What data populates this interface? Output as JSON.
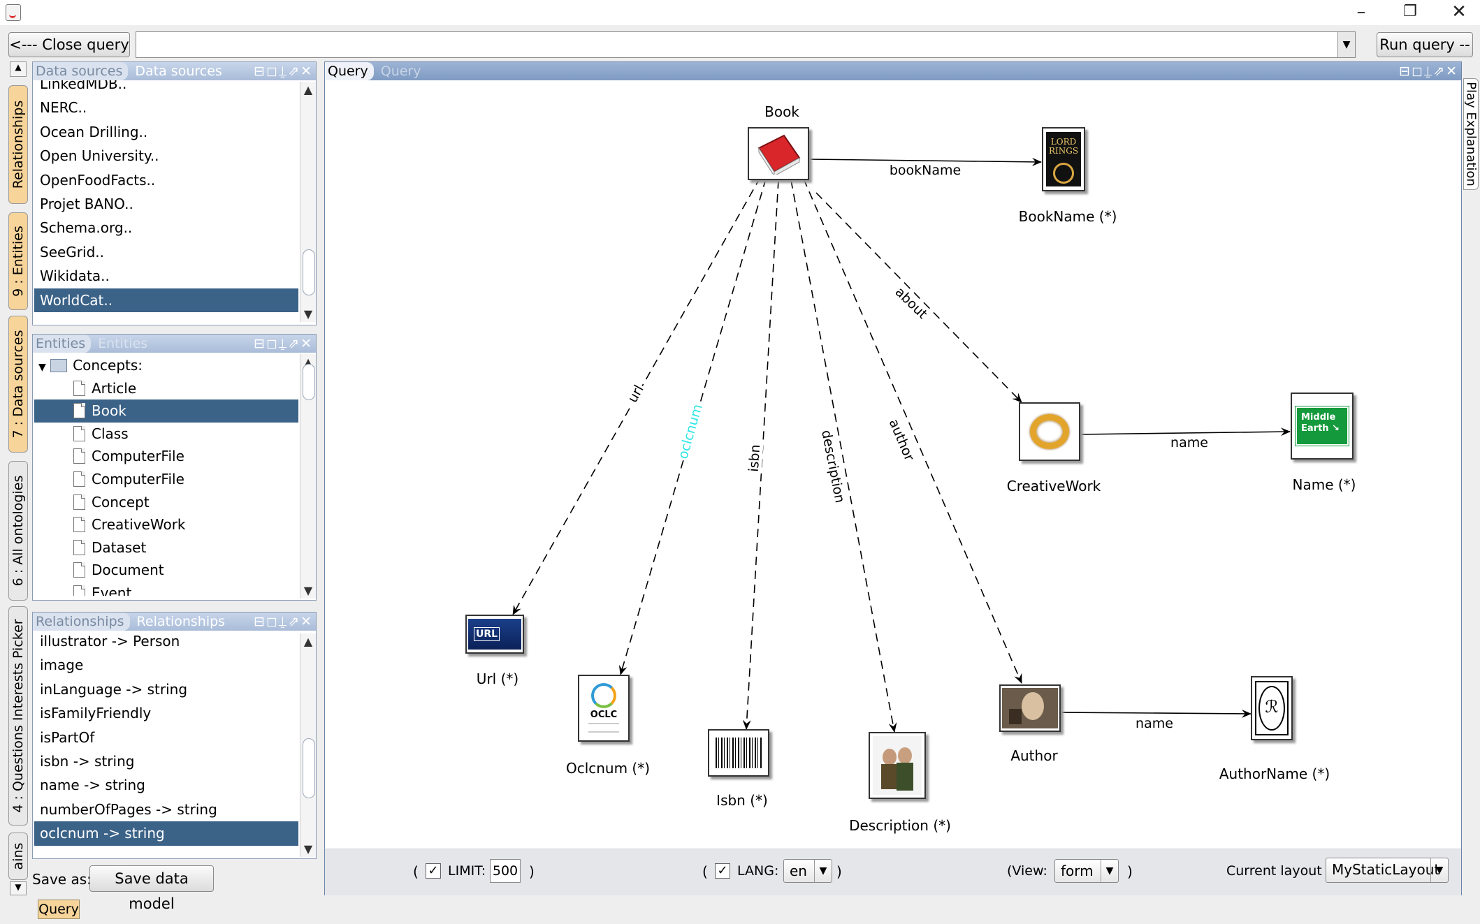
{
  "toolbar": {
    "close_query": "<--- Close query",
    "run_query": "Run query --->",
    "query_text": ""
  },
  "side_tabs": [
    {
      "label": "Relationships"
    },
    {
      "label": "9 : Entities"
    },
    {
      "label": "7 : Data sources"
    },
    {
      "label": "6 : All ontologies"
    },
    {
      "label": "4 : Questions Interests Picker"
    },
    {
      "label": "ains"
    }
  ],
  "datasources_panel": {
    "tab_inactive": "Data sources",
    "tab_active": "Data sources",
    "items": [
      "LinkedMDB..",
      "NERC..",
      "Ocean Drilling..",
      "Open University..",
      "OpenFoodFacts..",
      "Projet BANO..",
      "Schema.org..",
      "SeeGrid..",
      "Wikidata..",
      "WorldCat.."
    ],
    "selected": "WorldCat.."
  },
  "entities_panel": {
    "tab_inactive": "Entities",
    "tab_active": "Entities",
    "root": "Concepts:",
    "items": [
      "Article",
      "Book",
      "Class",
      "ComputerFile",
      "ComputerFile",
      "Concept",
      "CreativeWork",
      "Dataset",
      "Document",
      "Event"
    ],
    "selected": "Book"
  },
  "relationships_panel": {
    "tab_inactive": "Relationships",
    "tab_active": "Relationships",
    "items": [
      "illustrator -> Person",
      "image",
      "inLanguage -> string",
      "isFamilyFriendly",
      "isPartOf",
      "isbn -> string",
      "name -> string",
      "numberOfPages -> string",
      "oclcnum -> string"
    ],
    "selected": "oclcnum -> string"
  },
  "save": {
    "label": "Save as:",
    "button": "Save data model"
  },
  "query_panel": {
    "tab_active": "Query",
    "tab_inactive": "Query",
    "right_tab": "Play Explanation"
  },
  "graph": {
    "nodes": [
      {
        "id": "book",
        "label": "Book",
        "icon": "red-book-icon"
      },
      {
        "id": "bookname",
        "label": "BookName (*)",
        "icon": "lord-of-the-rings-cover-icon"
      },
      {
        "id": "creativework",
        "label": "CreativeWork",
        "icon": "golden-ring-icon"
      },
      {
        "id": "name",
        "label": "Name (*)",
        "icon": "middle-earth-sign-icon"
      },
      {
        "id": "url",
        "label": "Url (*)",
        "icon": "url-badge-icon"
      },
      {
        "id": "oclcnum",
        "label": "Oclcnum (*)",
        "icon": "oclc-logo-icon"
      },
      {
        "id": "isbn",
        "label": "Isbn (*)",
        "icon": "barcode-icon"
      },
      {
        "id": "description",
        "label": "Description (*)",
        "icon": "hobbits-picture-icon"
      },
      {
        "id": "author",
        "label": "Author",
        "icon": "author-portrait-icon"
      },
      {
        "id": "authorname",
        "label": "AuthorName (*)",
        "icon": "tolkien-monogram-icon"
      }
    ],
    "edges": [
      {
        "from": "book",
        "to": "bookname",
        "label": "bookName",
        "style": "solid"
      },
      {
        "from": "creativework",
        "to": "name",
        "label": "name",
        "style": "solid"
      },
      {
        "from": "author",
        "to": "authorname",
        "label": "name",
        "style": "solid"
      },
      {
        "from": "book",
        "to": "creativework",
        "label": "about",
        "style": "dashed"
      },
      {
        "from": "book",
        "to": "url",
        "label": "url",
        "style": "dashed"
      },
      {
        "from": "book",
        "to": "oclcnum",
        "label": "oclcnum",
        "style": "dashed",
        "highlight": "#2ee6e6"
      },
      {
        "from": "book",
        "to": "isbn",
        "label": "isbn",
        "style": "dashed"
      },
      {
        "from": "book",
        "to": "description",
        "label": "description",
        "style": "dashed"
      },
      {
        "from": "book",
        "to": "author",
        "label": "author",
        "style": "dashed"
      }
    ]
  },
  "bottom": {
    "limit_label": "LIMIT:",
    "limit_value": "500",
    "lang_label": "LANG:",
    "lang_value": "en",
    "view_label": "(View:",
    "view_value": "form",
    "layout_label": "Current layout :",
    "layout_value": "MyStaticLayout",
    "open_paren": "(",
    "close_paren": ")"
  },
  "status": {
    "query_tab": "Query"
  },
  "colors": {
    "selection": "#3b6287",
    "panel_header": "#a9bcd8",
    "highlight_label": "#2ee6e6"
  }
}
